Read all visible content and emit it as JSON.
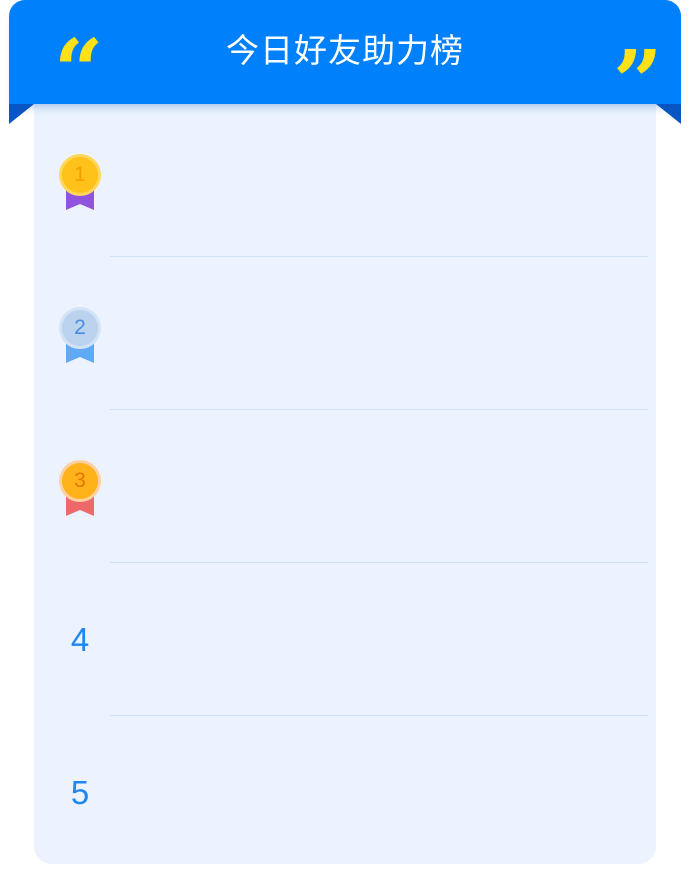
{
  "banner": {
    "title": "今日好友助力榜",
    "quote_open": "“",
    "quote_close": "”",
    "quote_color": "#ffe11a",
    "background_color": "#0080fa"
  },
  "leaderboard": {
    "rows": [
      {
        "rank": "1",
        "badge": "gold-medal-icon"
      },
      {
        "rank": "2",
        "badge": "silver-medal-icon"
      },
      {
        "rank": "3",
        "badge": "bronze-medal-icon"
      },
      {
        "rank": "4",
        "badge": null
      },
      {
        "rank": "5",
        "badge": null
      }
    ]
  },
  "colors": {
    "card_background": "#ecf3fe",
    "divider": "#cde1f7",
    "rank_text": "#1e86f0"
  }
}
